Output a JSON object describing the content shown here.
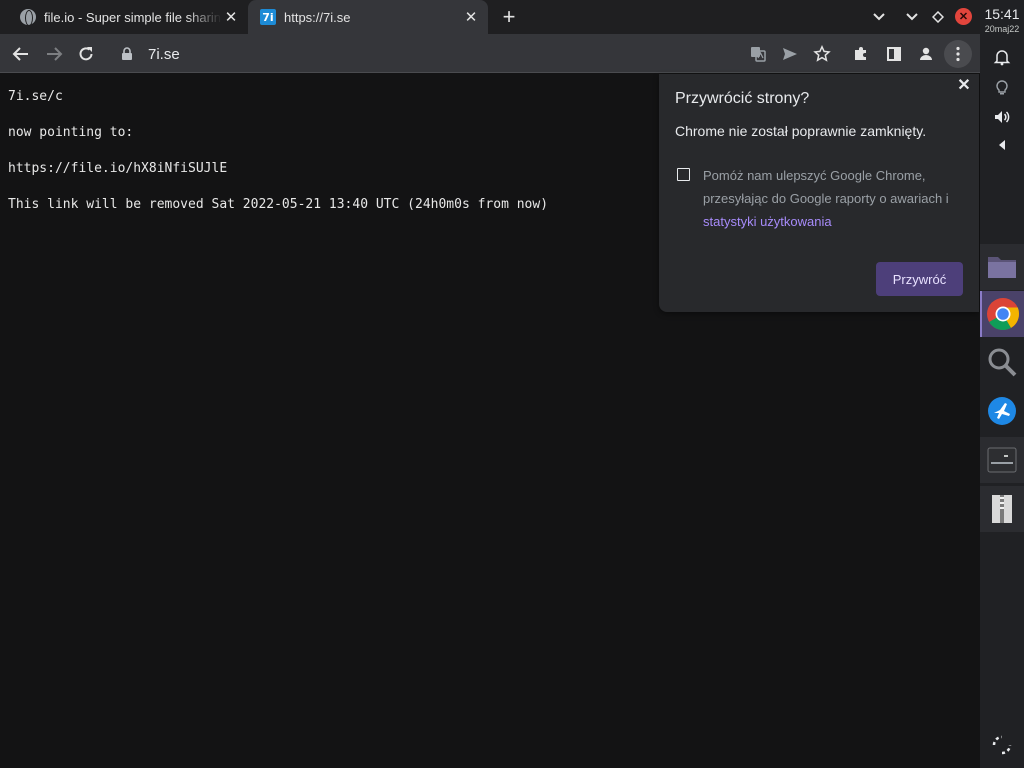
{
  "tabs": [
    {
      "title": "file.io - Super simple file sharing",
      "favicon": "globe-icon",
      "active": false
    },
    {
      "title": "https://7i.se",
      "favicon": "7i-favicon",
      "favicon_text": "7i",
      "active": true
    }
  ],
  "toolbar": {
    "url": "7i.se"
  },
  "page": {
    "lines": [
      "7i.se/c",
      "now pointing to:",
      "https://file.io/hX8iNfiSUJlE",
      "This link will be removed Sat 2022-05-21 13:40 UTC (24h0m0s from now)"
    ]
  },
  "restore_bubble": {
    "title": "Przywrócić strony?",
    "message": "Chrome nie został poprawnie zamknięty.",
    "checkbox_text": "Pomóż nam ulepszyć Google Chrome, przesyłając do Google raporty o awariach i",
    "checkbox_link": "statystyki użytkowania",
    "checkbox_checked": false,
    "restore_label": "Przywróć"
  },
  "shelf": {
    "time": "15:41",
    "date": "20maj22",
    "apps": [
      "files-app",
      "chrome-app",
      "search-app",
      "vpn-app",
      "terminal-app",
      "archive-app"
    ]
  },
  "colors": {
    "accent": "#4d3f7a",
    "link": "#a78bfa",
    "close_red": "#e2453c"
  }
}
